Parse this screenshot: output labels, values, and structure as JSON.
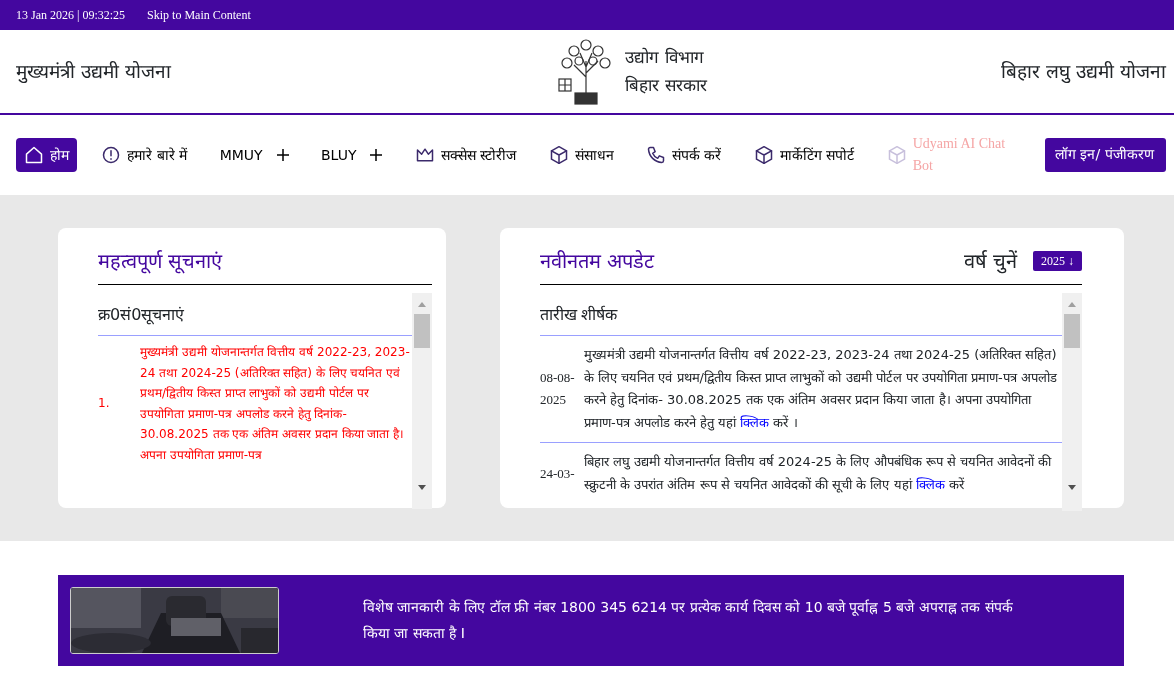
{
  "top_bar": {
    "datetime": "13 Jan 2026 | 09:32:25",
    "skip_link": "Skip to Main Content"
  },
  "header": {
    "left_title": "मुख्यमंत्री उद्यमी योजना",
    "department": [
      "उद्योग विभाग",
      "बिहार सरकार"
    ],
    "right_title": "बिहार लघु उद्यमी योजना"
  },
  "nav": {
    "items": [
      {
        "label": "होम",
        "kind": "home",
        "selected": true,
        "disabled": false
      },
      {
        "label": "हमारे बारे में",
        "kind": "info",
        "selected": false,
        "disabled": false
      },
      {
        "label": "MMUY",
        "kind": "expand",
        "selected": false,
        "disabled": false
      },
      {
        "label": "BLUY",
        "kind": "expand",
        "selected": false,
        "disabled": false
      },
      {
        "label": "सक्सेस स्टोरीज",
        "kind": "crown",
        "selected": false,
        "disabled": false
      },
      {
        "label": "संसाधन",
        "kind": "cube",
        "selected": false,
        "disabled": false
      },
      {
        "label": "संपर्क करें",
        "kind": "phone",
        "selected": false,
        "disabled": false
      },
      {
        "label": "मार्केटिंग सपोर्ट",
        "kind": "cube",
        "selected": false,
        "disabled": false
      },
      {
        "label": "Udyami AI Chat Bot",
        "kind": "cube",
        "selected": false,
        "disabled": true
      }
    ],
    "login_button": "लॉग इन/ पंजीकरण"
  },
  "notices": {
    "title": "महत्वपूर्ण सूचनाएं",
    "header": "क्र0सं0सूचनाएं",
    "rows": [
      {
        "number": "1.",
        "text": "मुख्यमंत्री उद्यमी योजनान्तर्गत वित्तीय वर्ष 2022-23, 2023-24 तथा 2024-25 (अतिरिक्त सहित) के लिए चयनित एवं प्रथम/द्वितीय किस्त प्राप्त लाभुकों को उद्यमी पोर्टल पर उपयोगिता प्रमाण-पत्र अपलोड करने हेतु दिनांक- 30.08.2025 तक एक अंतिम अवसर प्रदान किया जाता है। अपना उपयोगिता प्रमाण-पत्र"
      }
    ]
  },
  "updates": {
    "title": "नवीनतम अपडेट",
    "year_label": "वर्ष चुनें",
    "year_select": "2025 ↓",
    "columns": [
      "तारीख",
      "शीर्षक"
    ],
    "rows": [
      {
        "date": "08-08-2025",
        "text": "मुख्यमंत्री उद्यमी योजनान्तर्गत वित्तीय वर्ष 2022-23, 2023-24 तथा 2024-25 (अतिरिक्त सहित) के लिए चयनित एवं प्रथम/द्वितीय किस्त प्राप्त लाभुकों को उद्यमी पोर्टल पर उपयोगिता प्रमाण-पत्र अपलोड करने हेतु दिनांक- 30.08.2025 तक एक अंतिम अवसर प्रदान किया जाता है। अपना उपयोगिता प्रमाण-पत्र अपलोड करने हेतु यहां",
        "link": "क्लिक",
        "text_after": "करें ।"
      },
      {
        "date": "24-03-",
        "text": "बिहार लघु उद्यमी योजनान्तर्गत वित्तीय वर्ष 2024-25 के लिए औपबंधिक रूप से चयनित आवेदनों की स्क्रुटनी के उपरांत अंतिम रूप से चयनित आवेदकों की सूची के लिए यहां",
        "link": "क्लिक",
        "text_after": "करें"
      }
    ]
  },
  "banner": {
    "text": "विशेष जानकारी के लिए टॉल फ्री नंबर 1800 345 6214 पर प्रत्येक कार्य दिवस को 10 बजे पूर्वाह्न 5 बजे अपराह्न तक संपर्क किया जा सकता है I"
  }
}
